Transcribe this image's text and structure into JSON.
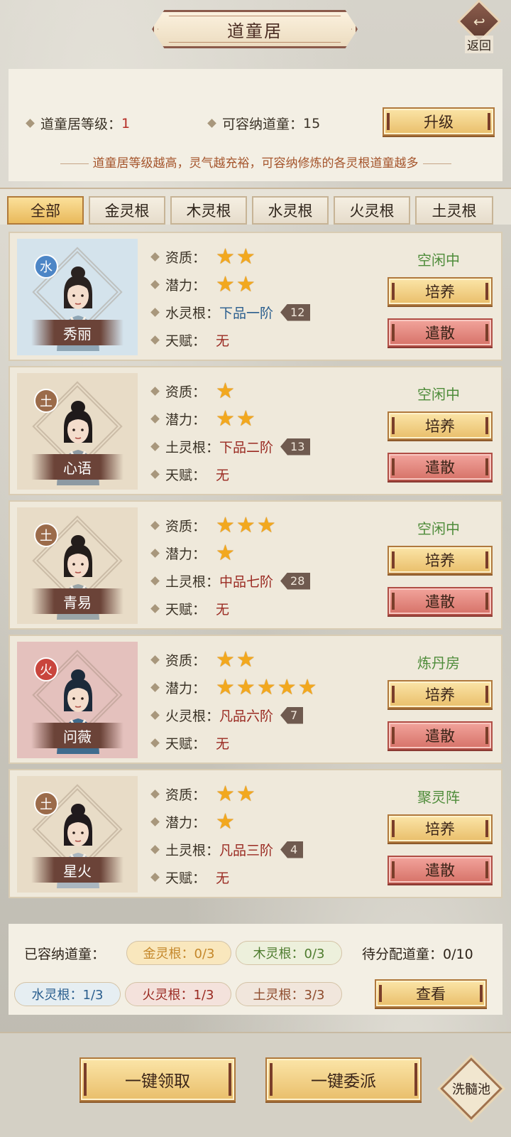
{
  "header": {
    "title": "道童居",
    "back_label": "返回"
  },
  "info": {
    "level_label": "道童居等级：",
    "level_value": "1",
    "capacity_label": "可容纳道童：",
    "capacity_value": "15",
    "upgrade_label": "升级",
    "description": "道童居等级越高，灵气越充裕，可容纳修炼的各灵根道童越多"
  },
  "tabs": [
    "全部",
    "金灵根",
    "木灵根",
    "水灵根",
    "火灵根",
    "土灵根"
  ],
  "active_tab": "全部",
  "labels": {
    "aptitude": "资质：",
    "potential": "潜力：",
    "talent": "天赋：",
    "train": "培养",
    "dismiss": "遣散"
  },
  "disciples": [
    {
      "name": "秀丽",
      "element": "水",
      "root_label": "水灵根：",
      "root_value": "下品一阶",
      "level": "12",
      "aptitude_stars": 2,
      "potential_stars": 2,
      "talent": "无",
      "status": "空闲中"
    },
    {
      "name": "心语",
      "element": "土",
      "root_label": "土灵根：",
      "root_value": "下品二阶",
      "level": "13",
      "aptitude_stars": 1,
      "potential_stars": 2,
      "talent": "无",
      "status": "空闲中"
    },
    {
      "name": "青易",
      "element": "土",
      "root_label": "土灵根：",
      "root_value": "中品七阶",
      "level": "28",
      "aptitude_stars": 3,
      "potential_stars": 1,
      "talent": "无",
      "status": "空闲中"
    },
    {
      "name": "问薇",
      "element": "火",
      "root_label": "火灵根：",
      "root_value": "凡品六阶",
      "level": "7",
      "aptitude_stars": 2,
      "potential_stars": 5,
      "talent": "无",
      "status": "炼丹房"
    },
    {
      "name": "星火",
      "element": "土",
      "root_label": "土灵根：",
      "root_value": "凡品三阶",
      "level": "4",
      "aptitude_stars": 2,
      "potential_stars": 1,
      "talent": "无",
      "status": "聚灵阵"
    }
  ],
  "summary": {
    "contained_label": "已容纳道童：",
    "gold": "金灵根：0/3",
    "wood": "木灵根：0/3",
    "pending": "待分配道童：0/10",
    "water": "水灵根：1/3",
    "fire": "火灵根：1/3",
    "earth": "土灵根：3/3",
    "view_label": "查看"
  },
  "footer": {
    "claim_all": "一键领取",
    "dispatch_all": "一键委派",
    "wash_pool": "洗髓池"
  },
  "colors": {
    "gold_button": "#e9be6a",
    "red_button": "#d67268",
    "status_green": "#4e8c3a",
    "star": "#f2a81e"
  }
}
